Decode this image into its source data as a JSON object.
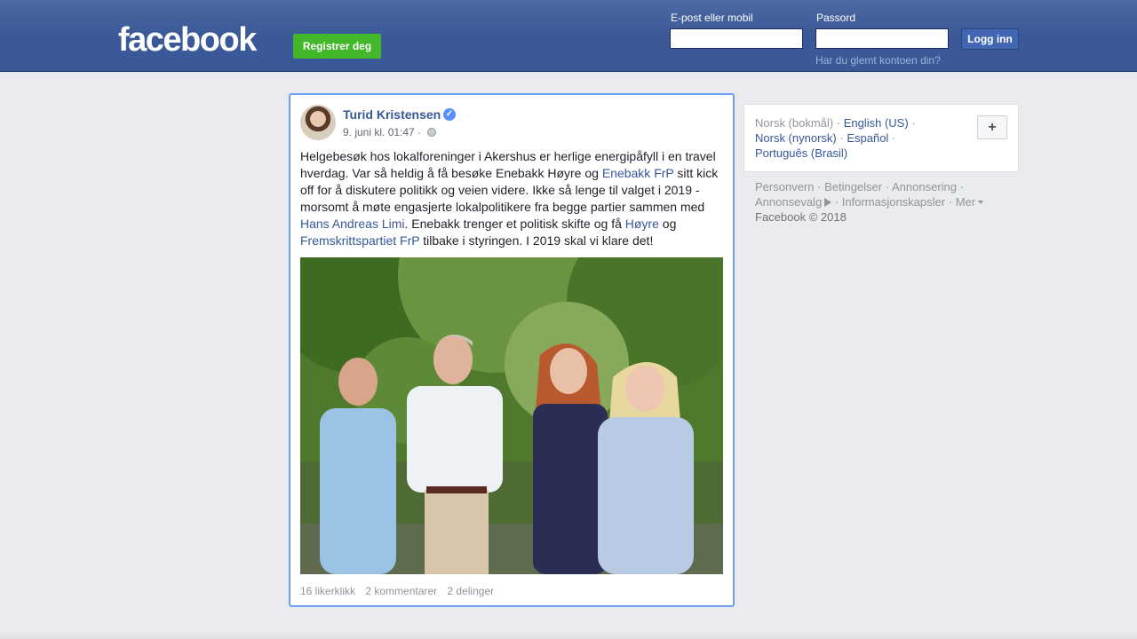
{
  "header": {
    "logo_text": "facebook",
    "register_label": "Registrer deg",
    "email_label": "E-post eller mobil",
    "email_value": "",
    "password_label": "Passord",
    "password_value": "",
    "login_label": "Logg inn",
    "forgot_label": "Har du glemt kontoen din?"
  },
  "post": {
    "author": "Turid Kristensen",
    "verified_icon": "verified-check-icon",
    "timestamp": "9. juni kl. 01:47",
    "separator": "·",
    "privacy_icon": "globe-icon",
    "text": {
      "part1": "Helgebesøk hos lokalforeninger i Akershus er herlige energipåfyll i en travel hverdag. Var så heldig å få besøke Enebakk Høyre og ",
      "link1": "Enebakk FrP",
      "part2": " sitt kick off for å diskutere politikk og veien videre. Ikke så lenge til valget i 2019 - morsomt å møte engasjerte lokalpolitikere fra begge partier sammen med ",
      "link2": "Hans Andreas Limi",
      "part3": ". Enebakk trenger et politisk skifte og få ",
      "link3": "Høyre",
      "part4": " og ",
      "link4": "Fremskrittspartiet FrP",
      "part5": " tilbake i styringen. I 2019 skal vi klare det!"
    },
    "stats": {
      "likes": "16 likerklikk",
      "comments": "2 kommentarer",
      "shares": "2 delinger"
    }
  },
  "languages": {
    "current": "Norsk (bokmål)",
    "items": [
      "English (US)",
      "Norsk (nynorsk)",
      "Español",
      "Português (Brasil)"
    ],
    "separator": "·",
    "add_label": "+"
  },
  "footer": {
    "links": [
      "Personvern",
      "Betingelser",
      "Annonsering",
      "Annonsevalg",
      "Informasjonskapsler",
      "Mer"
    ],
    "separator": "·",
    "copyright": "Facebook © 2018"
  },
  "colors": {
    "brand": "#3b5998",
    "link": "#365899",
    "register": "#42b72a",
    "highlight_border": "#6ea1f5"
  }
}
